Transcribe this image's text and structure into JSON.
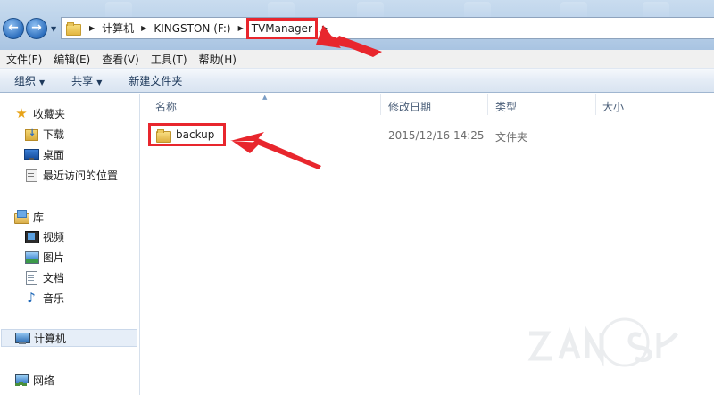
{
  "address_bar": {
    "crumbs": [
      "计算机",
      "KINGSTON (F:)",
      "TVManager"
    ],
    "highlighted_crumb": "TVManager"
  },
  "menu": {
    "items": [
      "文件(F)",
      "编辑(E)",
      "查看(V)",
      "工具(T)",
      "帮助(H)"
    ]
  },
  "commands": {
    "organize": "组织",
    "share": "共享",
    "new_folder": "新建文件夹"
  },
  "nav": {
    "favorites": {
      "label": "收藏夹",
      "items": [
        "下载",
        "桌面",
        "最近访问的位置"
      ]
    },
    "libraries": {
      "label": "库",
      "items": [
        "视频",
        "图片",
        "文档",
        "音乐"
      ]
    },
    "computer": "计算机",
    "network": "网络"
  },
  "columns": {
    "name": "名称",
    "modified": "修改日期",
    "type": "类型",
    "size": "大小"
  },
  "files": [
    {
      "name": "backup",
      "modified": "2015/12/16 14:25",
      "type": "文件夹",
      "size": ""
    }
  ],
  "annotation_color": "#e8262d",
  "selected_nav": "计算机"
}
